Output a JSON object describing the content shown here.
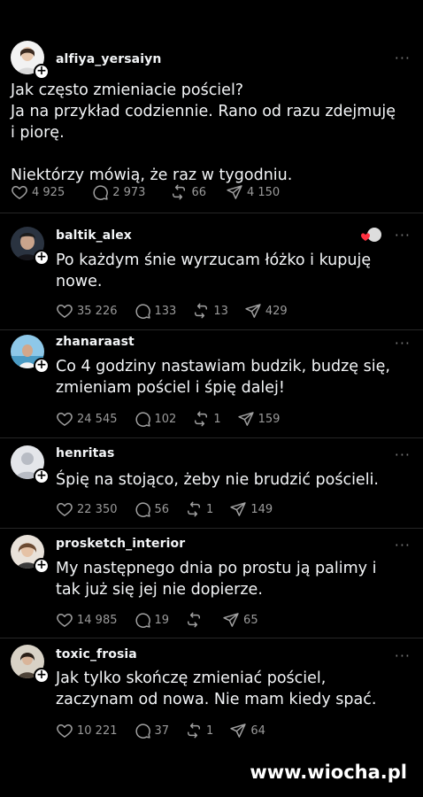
{
  "main_post": {
    "username": "alfiya_yersaiyn",
    "text": "Jak często zmieniacie pościel?\nJa na przykład codziennie. Rano od razu zdejmuję i piorę.\n\nNiektórzy mówią, że raz w tygodniu.",
    "likes": "4 925",
    "comments": "2 973",
    "reposts": "66",
    "shares": "4 150"
  },
  "replies": [
    {
      "username": "baltik_alex",
      "text": "Po każdym śnie wyrzucam łóżko i kupuję nowe.",
      "likes": "35 226",
      "comments": "133",
      "reposts": "13",
      "shares": "429"
    },
    {
      "username": "zhanaraast",
      "text": "Co 4 godziny nastawiam budzik, budzę się, zmieniam pościel i śpię dalej!",
      "likes": "24 545",
      "comments": "102",
      "reposts": "1",
      "shares": "159"
    },
    {
      "username": "henritas",
      "text": "Śpię na stojąco, żeby nie brudzić pościeli.",
      "likes": "22 350",
      "comments": "56",
      "reposts": "1",
      "shares": "149"
    },
    {
      "username": "prosketch_interior",
      "text": "My następnego dnia po prostu ją palimy i tak już się jej nie dopierze.",
      "likes": "14 985",
      "comments": "19",
      "reposts": "",
      "shares": "65"
    },
    {
      "username": "toxic_frosia",
      "text": "Jak tylko skończę zmieniać pościel, zaczynam od nowa. Nie mam kiedy spać.",
      "likes": "10 221",
      "comments": "37",
      "reposts": "1",
      "shares": "64"
    }
  ],
  "icons": {
    "like": "heart-icon",
    "comment": "comment-icon",
    "repost": "repost-icon",
    "share": "share-icon",
    "more": "more-icon"
  },
  "ui": {
    "more_label": "···",
    "plus_label": "+"
  },
  "watermark": "www.wiocha.pl"
}
